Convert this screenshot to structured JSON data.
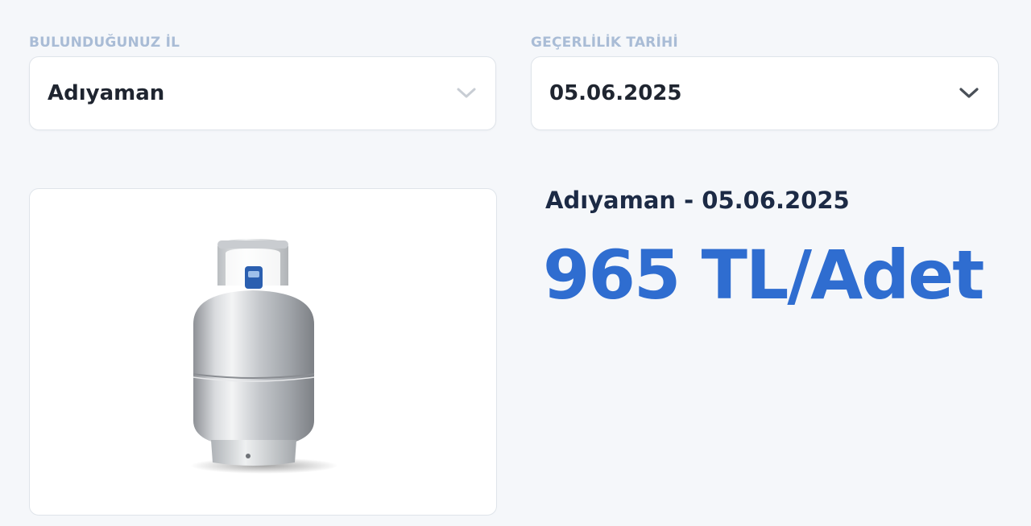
{
  "province": {
    "label": "BULUNDUĞUNUZ İL",
    "value": "Adıyaman"
  },
  "validity_date": {
    "label": "GEÇERLİLİK TARİHİ",
    "value": "05.06.2025"
  },
  "product": {
    "image_icon": "gas-cylinder-icon"
  },
  "result": {
    "heading": "Adıyaman - 05.06.2025",
    "price": "965 TL/Adet"
  },
  "colors": {
    "label": "#a9bcd6",
    "heading": "#1c2a45",
    "price": "#2f6dd0",
    "field_text": "#1f2530",
    "chevron_inactive": "#c8cdd4",
    "chevron_active": "#4a5058"
  }
}
